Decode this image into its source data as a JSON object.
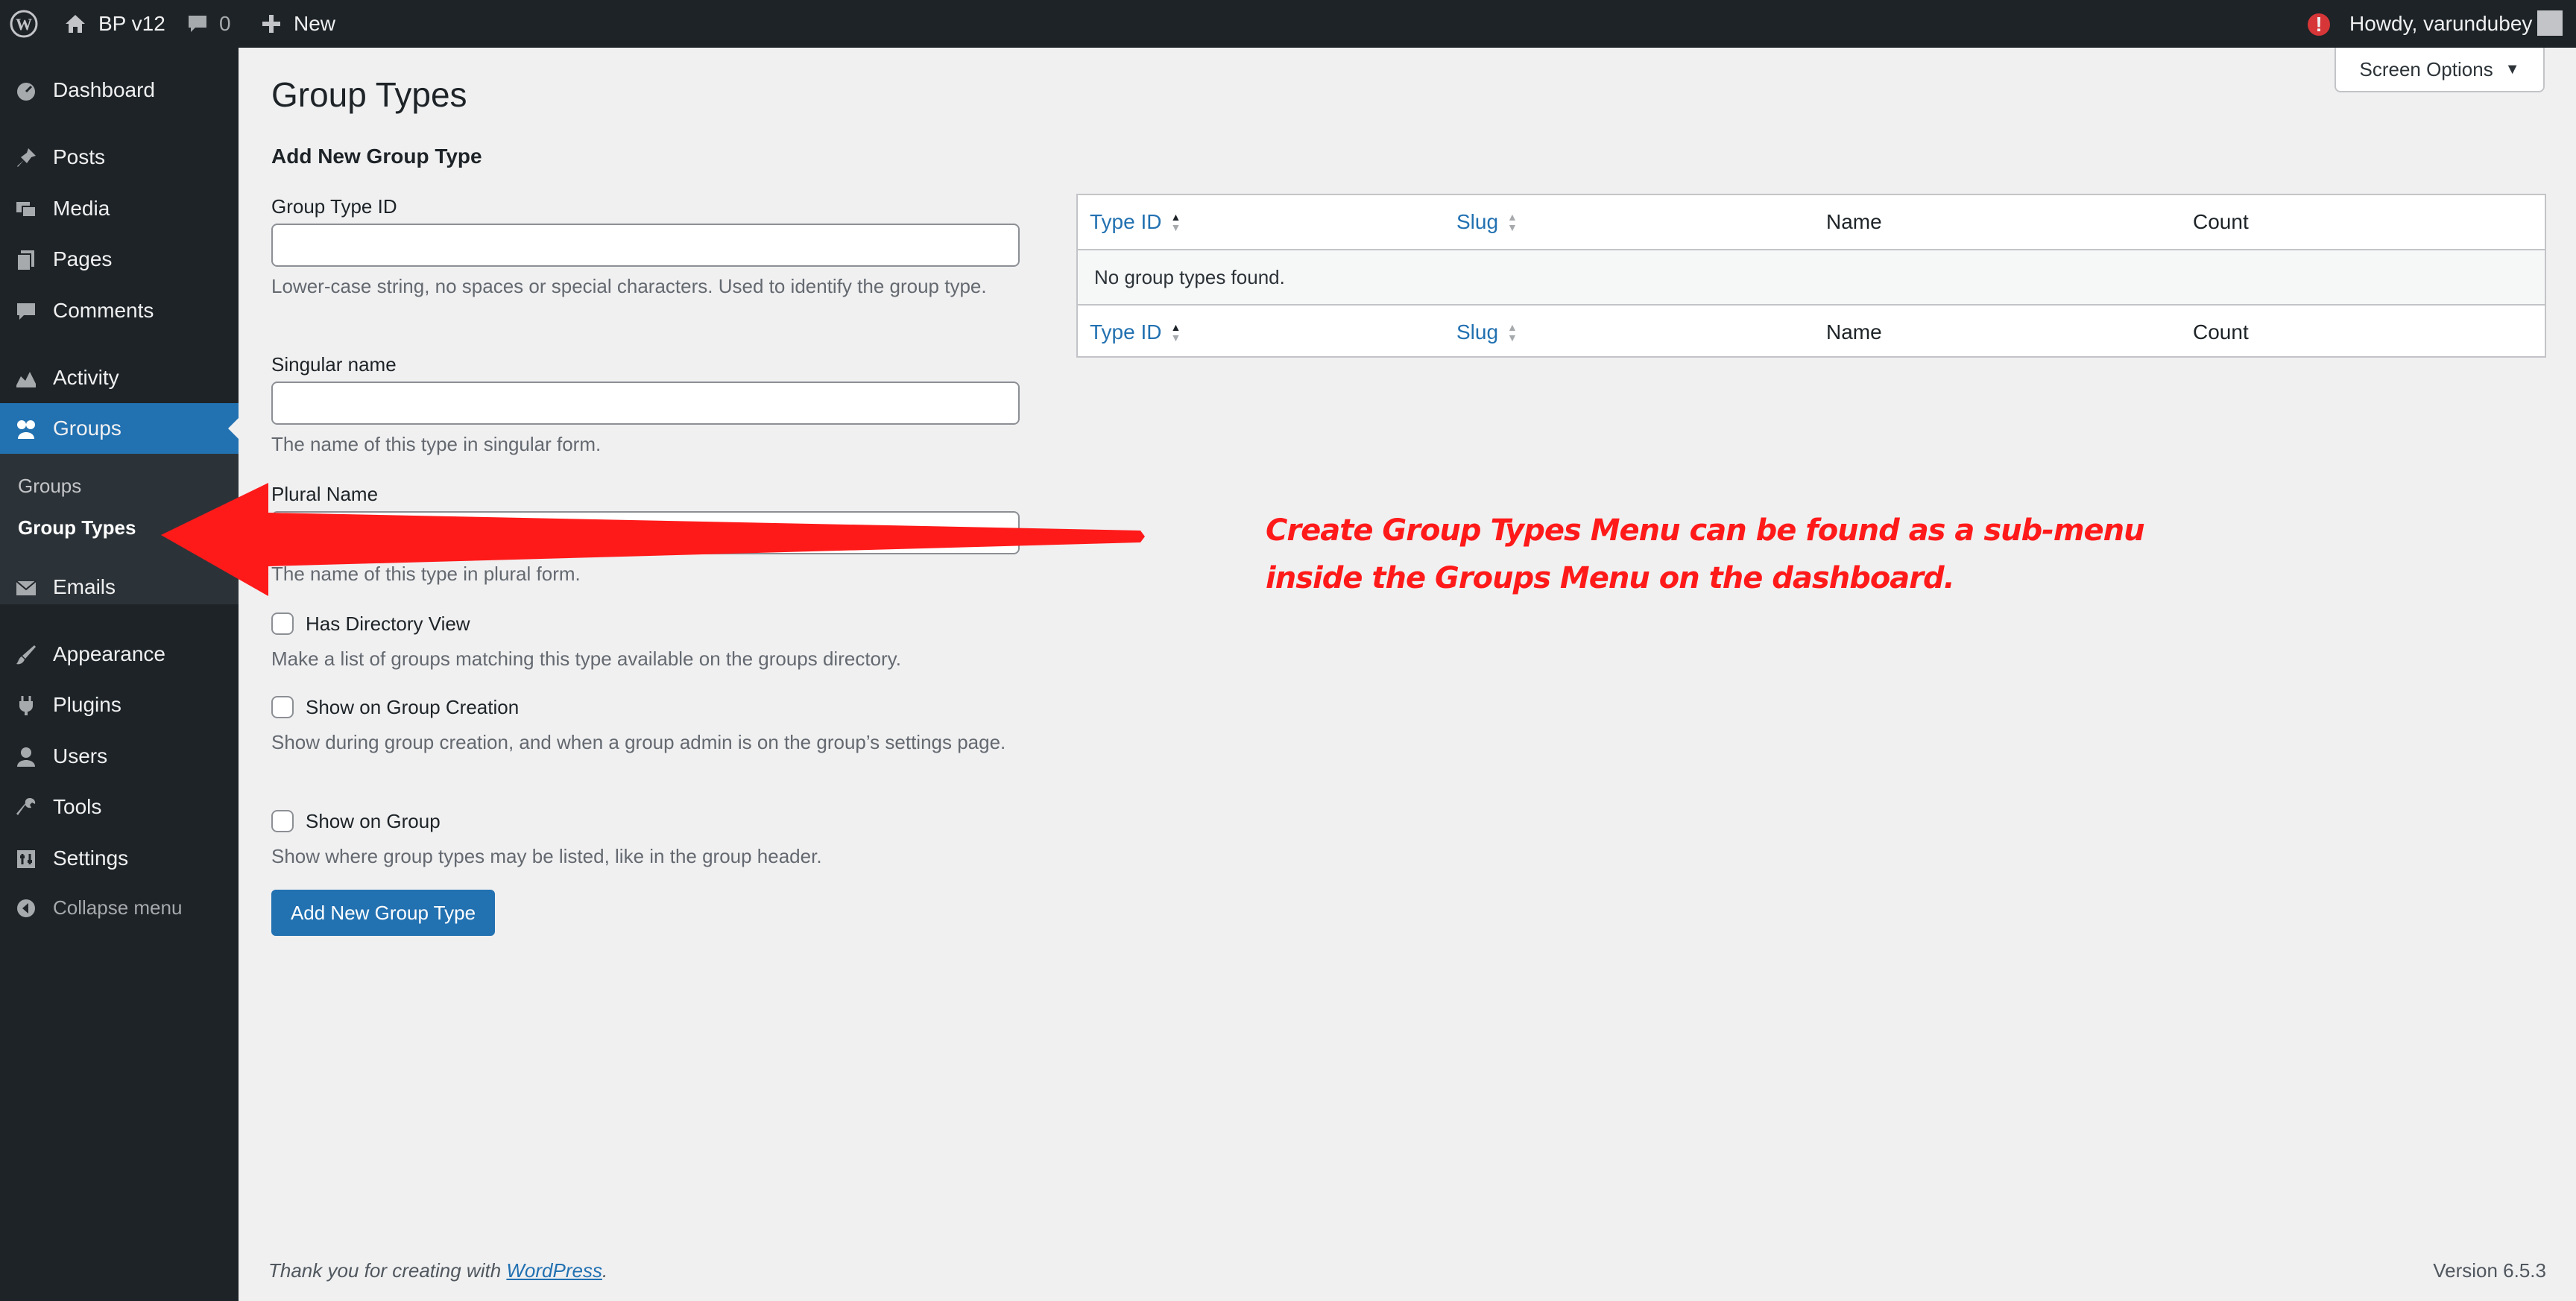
{
  "adminbar": {
    "site_name": "BP v12",
    "comments_count": "0",
    "new_label": "New",
    "notice_badge": "!",
    "howdy": "Howdy, varundubey"
  },
  "sidebar": {
    "items": [
      {
        "label": "Dashboard",
        "icon": "dashboard-icon"
      },
      {
        "label": "Posts",
        "icon": "pin-icon"
      },
      {
        "label": "Media",
        "icon": "media-icon"
      },
      {
        "label": "Pages",
        "icon": "pages-icon"
      },
      {
        "label": "Comments",
        "icon": "comment-icon"
      },
      {
        "label": "Activity",
        "icon": "activity-icon"
      },
      {
        "label": "Groups",
        "icon": "groups-icon"
      },
      {
        "label": "Emails",
        "icon": "mail-icon"
      },
      {
        "label": "Appearance",
        "icon": "brush-icon"
      },
      {
        "label": "Plugins",
        "icon": "plug-icon"
      },
      {
        "label": "Users",
        "icon": "user-icon"
      },
      {
        "label": "Tools",
        "icon": "wrench-icon"
      },
      {
        "label": "Settings",
        "icon": "settings-icon"
      }
    ],
    "submenu": [
      "Groups",
      "Group Types"
    ],
    "collapse_label": "Collapse menu"
  },
  "screen_options": "Screen Options",
  "page_title": "Group Types",
  "form": {
    "title": "Add New Group Type",
    "type_id_label": "Group Type ID",
    "type_id_value": "",
    "type_id_desc": "Lower-case string, no spaces or special characters. Used to identify the group type.",
    "singular_label": "Singular name",
    "singular_value": "",
    "singular_desc": "The name of this type in singular form.",
    "plural_label": "Plural Name",
    "plural_value": "",
    "plural_desc": "The name of this type in plural form.",
    "directory_label": "Has Directory View",
    "directory_desc": "Make a list of groups matching this type available on the groups directory.",
    "creation_label": "Show on Group Creation",
    "creation_desc": "Show during group creation, and when a group admin is on the group’s settings page.",
    "group_label": "Show on Group",
    "group_desc": "Show where group types may be listed, like in the group header.",
    "submit_label": "Add New Group Type"
  },
  "table": {
    "columns": [
      "Type ID",
      "Slug",
      "Name",
      "Count"
    ],
    "empty_message": "No group types found."
  },
  "annotation": {
    "line1": "Create Group Types Menu can be found as a sub-menu",
    "line2": "inside the Groups Menu on the dashboard.",
    "color": "#ff1a1a"
  },
  "footer": {
    "thanks_prefix": "Thank you for creating with ",
    "thanks_link": "WordPress",
    "thanks_suffix": ".",
    "version": "Version 6.5.3"
  },
  "colors": {
    "accent": "#2271b1",
    "sidebar_bg": "#1d2327"
  }
}
